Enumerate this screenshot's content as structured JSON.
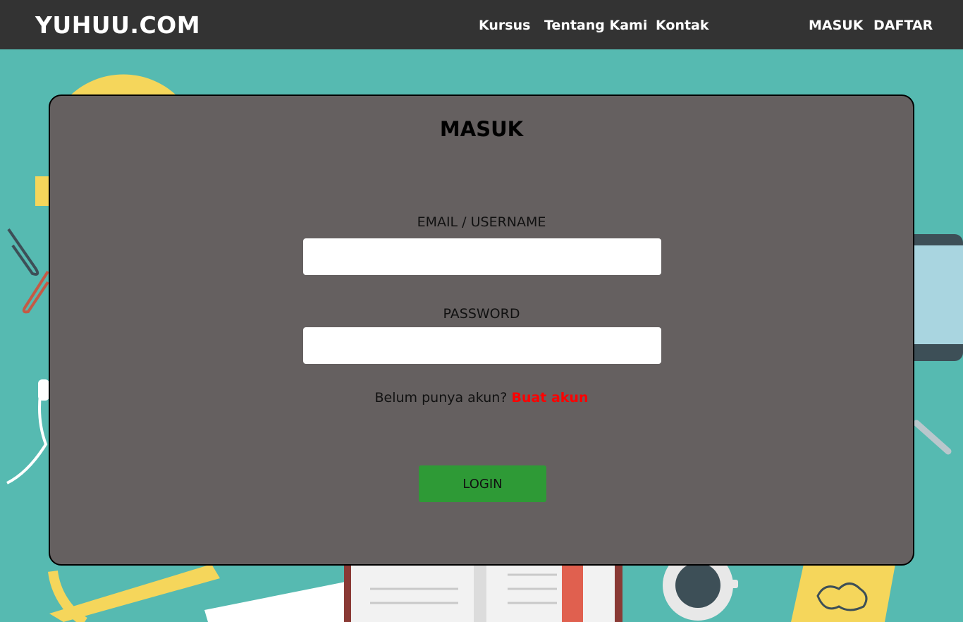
{
  "navbar": {
    "brand": "YUHUU.COM",
    "links": [
      "Kursus",
      "Tentang Kami",
      "Kontak"
    ],
    "auth": {
      "login": "MASUK",
      "register": "DAFTAR"
    }
  },
  "login_form": {
    "title": "MASUK",
    "email_label": "EMAIL / USERNAME",
    "email_value": "",
    "password_label": "PASSWORD",
    "password_value": "",
    "signup_prompt": "Belum punya akun?",
    "signup_link": "Buat akun",
    "submit_label": "LOGIN"
  },
  "colors": {
    "navbar_bg": "#333333",
    "page_bg": "#56bab1",
    "card_bg": "#656060",
    "link_red": "#ff0000",
    "button_green": "#2e9a36"
  }
}
